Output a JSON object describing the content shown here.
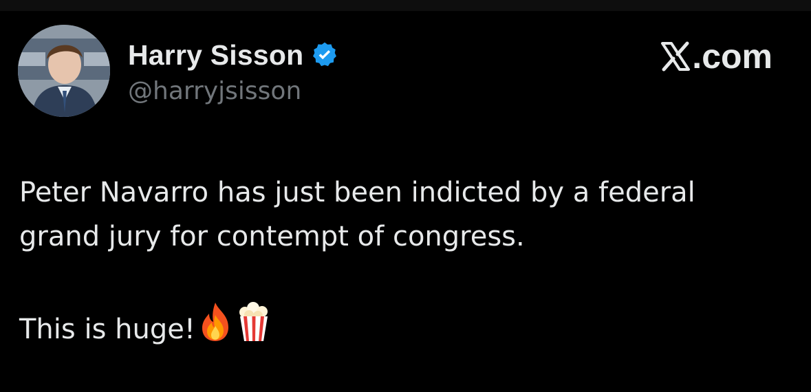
{
  "tweet": {
    "author": {
      "display_name": "Harry Sisson",
      "handle": "@harryjsisson",
      "verified": true,
      "avatar_icon": "profile-photo"
    },
    "brand": {
      "text": ".com",
      "icon": "x-logo-icon"
    },
    "text_lines": [
      "Peter Navarro has just been indicted by a federal",
      "grand jury for contempt of congress."
    ],
    "closing_line": "This is huge!",
    "emojis": [
      "fire-emoji-icon",
      "popcorn-emoji-icon"
    ]
  },
  "colors": {
    "background": "#000000",
    "primary_text": "#e7e9ea",
    "secondary_text": "#71767b",
    "verified_blue": "#1d9bf0"
  }
}
